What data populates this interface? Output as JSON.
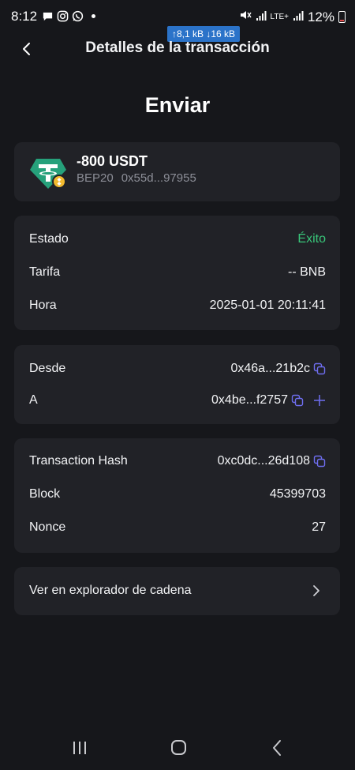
{
  "status_bar": {
    "time": "8:12",
    "signal_label": "LTE+",
    "battery": "12%",
    "net_speed": "↑8,1 kB ↓16 kB"
  },
  "header": {
    "title": "Detalles de la transacción"
  },
  "page_heading": "Enviar",
  "token": {
    "amount": "-800 USDT",
    "network": "BEP20",
    "address": "0x55d...97955",
    "brand_color": "#26a17b",
    "badge_color": "#f3ba2f"
  },
  "status_card": {
    "rows": [
      {
        "label": "Estado",
        "value": "Éxito"
      },
      {
        "label": "Tarifa",
        "value": "-- BNB"
      },
      {
        "label": "Hora",
        "value": "2025-01-01 20:11:41"
      }
    ]
  },
  "address_card": {
    "from_label": "Desde",
    "from_value": "0x46a...21b2c",
    "to_label": "A",
    "to_value": "0x4be...f2757"
  },
  "chain_card": {
    "hash_label": "Transaction Hash",
    "hash_value": "0xc0dc...26d108",
    "block_label": "Block",
    "block_value": "45399703",
    "nonce_label": "Nonce",
    "nonce_value": "27"
  },
  "explorer": {
    "label": "Ver en explorador de cadena"
  },
  "colors": {
    "background": "#16171b",
    "card": "#212227",
    "success": "#39c77a",
    "accent": "#6f6ef0"
  }
}
